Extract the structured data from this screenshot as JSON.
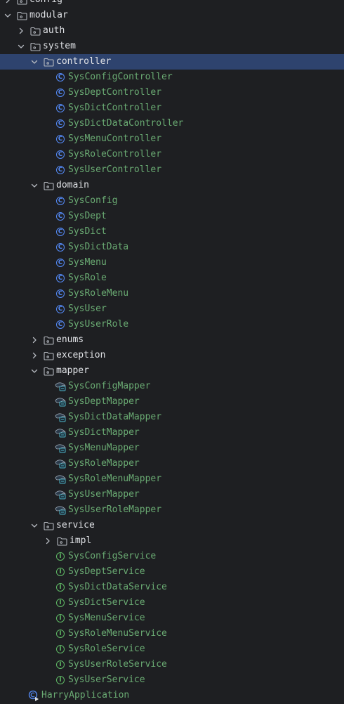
{
  "tree": {
    "rows": [
      {
        "label": "config",
        "kind": "folder",
        "depth": 2,
        "state": "collapsed",
        "partial": true
      },
      {
        "label": "modular",
        "kind": "folder",
        "depth": 2,
        "state": "expanded"
      },
      {
        "label": "auth",
        "kind": "folder",
        "depth": 3,
        "state": "collapsed"
      },
      {
        "label": "system",
        "kind": "folder",
        "depth": 3,
        "state": "expanded"
      },
      {
        "label": "controller",
        "kind": "folder",
        "depth": 4,
        "state": "expanded",
        "selected": true
      },
      {
        "label": "SysConfigController",
        "kind": "class",
        "depth": 5
      },
      {
        "label": "SysDeptController",
        "kind": "class",
        "depth": 5
      },
      {
        "label": "SysDictController",
        "kind": "class",
        "depth": 5
      },
      {
        "label": "SysDictDataController",
        "kind": "class",
        "depth": 5
      },
      {
        "label": "SysMenuController",
        "kind": "class",
        "depth": 5
      },
      {
        "label": "SysRoleController",
        "kind": "class",
        "depth": 5
      },
      {
        "label": "SysUserController",
        "kind": "class",
        "depth": 5
      },
      {
        "label": "domain",
        "kind": "folder",
        "depth": 4,
        "state": "expanded"
      },
      {
        "label": "SysConfig",
        "kind": "class",
        "depth": 5
      },
      {
        "label": "SysDept",
        "kind": "class",
        "depth": 5
      },
      {
        "label": "SysDict",
        "kind": "class",
        "depth": 5
      },
      {
        "label": "SysDictData",
        "kind": "class",
        "depth": 5
      },
      {
        "label": "SysMenu",
        "kind": "class",
        "depth": 5
      },
      {
        "label": "SysRole",
        "kind": "class",
        "depth": 5
      },
      {
        "label": "SysRoleMenu",
        "kind": "class",
        "depth": 5
      },
      {
        "label": "SysUser",
        "kind": "class",
        "depth": 5
      },
      {
        "label": "SysUserRole",
        "kind": "class",
        "depth": 5
      },
      {
        "label": "enums",
        "kind": "folder",
        "depth": 4,
        "state": "collapsed"
      },
      {
        "label": "exception",
        "kind": "folder",
        "depth": 4,
        "state": "collapsed"
      },
      {
        "label": "mapper",
        "kind": "folder",
        "depth": 4,
        "state": "expanded"
      },
      {
        "label": "SysConfigMapper",
        "kind": "mapper",
        "depth": 5
      },
      {
        "label": "SysDeptMapper",
        "kind": "mapper",
        "depth": 5
      },
      {
        "label": "SysDictDataMapper",
        "kind": "mapper",
        "depth": 5
      },
      {
        "label": "SysDictMapper",
        "kind": "mapper",
        "depth": 5
      },
      {
        "label": "SysMenuMapper",
        "kind": "mapper",
        "depth": 5
      },
      {
        "label": "SysRoleMapper",
        "kind": "mapper",
        "depth": 5
      },
      {
        "label": "SysRoleMenuMapper",
        "kind": "mapper",
        "depth": 5
      },
      {
        "label": "SysUserMapper",
        "kind": "mapper",
        "depth": 5
      },
      {
        "label": "SysUserRoleMapper",
        "kind": "mapper",
        "depth": 5
      },
      {
        "label": "service",
        "kind": "folder",
        "depth": 4,
        "state": "expanded"
      },
      {
        "label": "impl",
        "kind": "folder",
        "depth": 5,
        "state": "collapsed"
      },
      {
        "label": "SysConfigService",
        "kind": "interface",
        "depth": 5
      },
      {
        "label": "SysDeptService",
        "kind": "interface",
        "depth": 5
      },
      {
        "label": "SysDictDataService",
        "kind": "interface",
        "depth": 5
      },
      {
        "label": "SysDictService",
        "kind": "interface",
        "depth": 5
      },
      {
        "label": "SysMenuService",
        "kind": "interface",
        "depth": 5
      },
      {
        "label": "SysRoleMenuService",
        "kind": "interface",
        "depth": 5
      },
      {
        "label": "SysRoleService",
        "kind": "interface",
        "depth": 5
      },
      {
        "label": "SysUserRoleService",
        "kind": "interface",
        "depth": 5
      },
      {
        "label": "SysUserService",
        "kind": "interface",
        "depth": 5
      },
      {
        "label": "HarryApplication",
        "kind": "app",
        "depth": 3
      }
    ]
  },
  "colors": {
    "background": "#1e1f22",
    "selection": "#2e436e",
    "folder_text": "#dfe1e5",
    "file_text": "#6aab73",
    "class_icon": "#548af7",
    "interface_icon": "#5fb865"
  }
}
